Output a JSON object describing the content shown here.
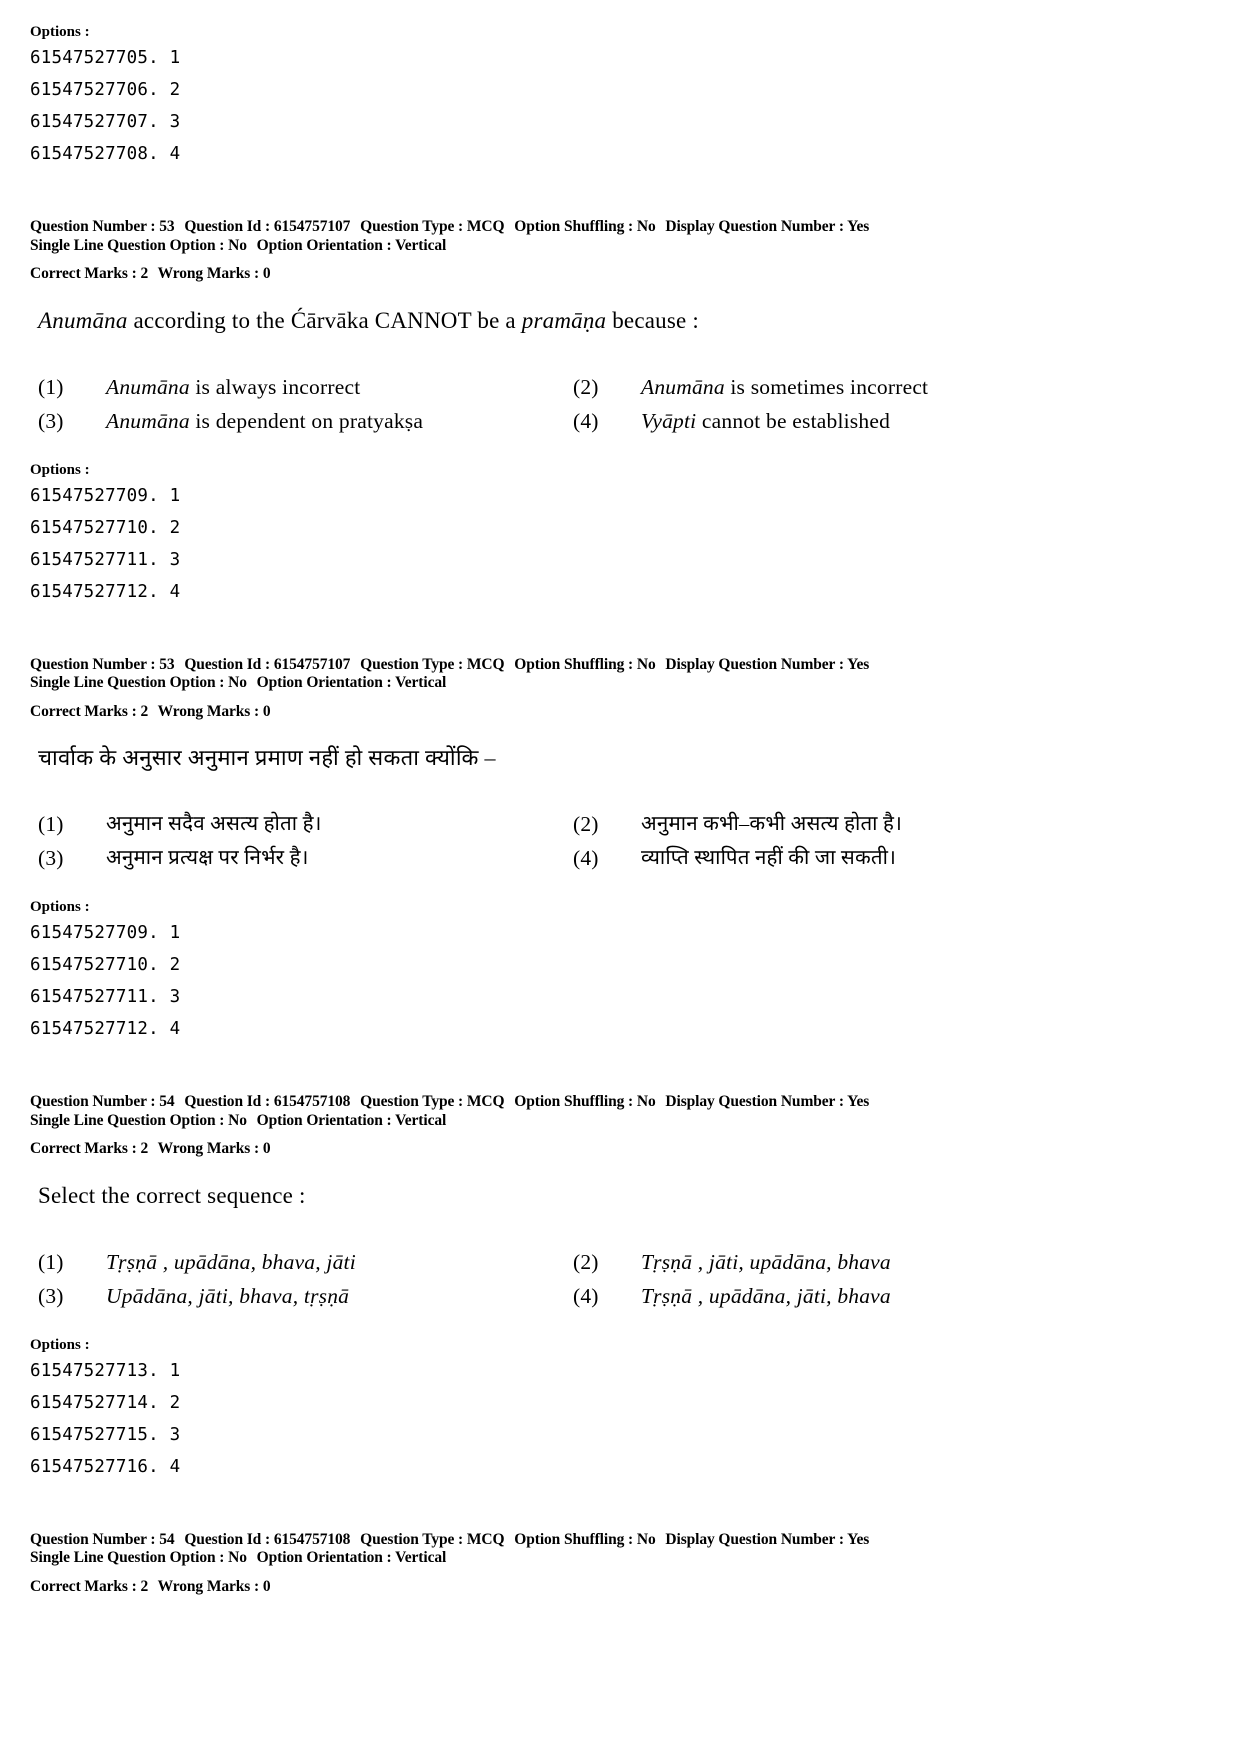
{
  "labels": {
    "options": "Options :",
    "question_number": "Question Number :",
    "question_id": "Question Id :",
    "question_type": "Question Type :",
    "option_shuffling": "Option Shuffling :",
    "display_question_number": "Display Question Number :",
    "single_line_question_option": "Single Line Question Option :",
    "option_orientation": "Option Orientation :",
    "correct_marks": "Correct Marks :",
    "wrong_marks": "Wrong Marks :"
  },
  "block_top_options": {
    "heading": "Options :",
    "ids": [
      "61547527705. 1",
      "61547527706. 2",
      "61547527707. 3",
      "61547527708. 4"
    ]
  },
  "q53_en": {
    "meta": {
      "question_number": "53",
      "question_id": "6154757107",
      "question_type": "MCQ",
      "option_shuffling": "No",
      "display_question_number": "Yes",
      "single_line_question_option": "No",
      "option_orientation": "Vertical",
      "correct_marks": "2",
      "wrong_marks": "0"
    },
    "stem_parts": {
      "p1": "Anumāna",
      "p2": " according to the Ćārvāka CANNOT be a ",
      "p3": "pramāṇa",
      "p4": "  because :"
    },
    "choices": [
      {
        "num": "(1)",
        "italic": "Anumāna",
        "rest": " is always incorrect"
      },
      {
        "num": "(2)",
        "italic": "Anumāna",
        "rest": " is sometimes incorrect"
      },
      {
        "num": "(3)",
        "italic": "Anumāna",
        "rest": " is dependent on pratyakṣa"
      },
      {
        "num": "(4)",
        "italic": "Vyāpti",
        "rest": " cannot be established"
      }
    ],
    "options": {
      "heading": "Options :",
      "ids": [
        "61547527709. 1",
        "61547527710. 2",
        "61547527711. 3",
        "61547527712. 4"
      ]
    }
  },
  "q53_hi": {
    "meta": {
      "question_number": "53",
      "question_id": "6154757107",
      "question_type": "MCQ",
      "option_shuffling": "No",
      "display_question_number": "Yes",
      "single_line_question_option": "No",
      "option_orientation": "Vertical",
      "correct_marks": "2",
      "wrong_marks": "0"
    },
    "stem": "चार्वाक के अनुसार अनुमान प्रमाण नहीं हो सकता क्योंकि –",
    "choices": [
      {
        "num": "(1)",
        "text": "अनुमान सदैव असत्य होता है।"
      },
      {
        "num": "(2)",
        "text": "अनुमान कभी–कभी असत्य होता है।"
      },
      {
        "num": "(3)",
        "text": "अनुमान प्रत्यक्ष पर निर्भर है।"
      },
      {
        "num": "(4)",
        "text": "व्याप्ति स्थापित नहीं की जा सकती।"
      }
    ],
    "options": {
      "heading": "Options :",
      "ids": [
        "61547527709. 1",
        "61547527710. 2",
        "61547527711. 3",
        "61547527712. 4"
      ]
    }
  },
  "q54_en": {
    "meta": {
      "question_number": "54",
      "question_id": "6154757108",
      "question_type": "MCQ",
      "option_shuffling": "No",
      "display_question_number": "Yes",
      "single_line_question_option": "No",
      "option_orientation": "Vertical",
      "correct_marks": "2",
      "wrong_marks": "0"
    },
    "stem": "Select the correct sequence :",
    "choices": [
      {
        "num": "(1)",
        "text": "Tṛṣṇā , upādāna, bhava, jāti"
      },
      {
        "num": "(2)",
        "text": "Tṛṣṇā , jāti, upādāna, bhava"
      },
      {
        "num": "(3)",
        "text": "Upādāna, jāti, bhava, tṛṣṇā"
      },
      {
        "num": "(4)",
        "text": "Tṛṣṇā , upādāna, jāti, bhava"
      }
    ],
    "options": {
      "heading": "Options :",
      "ids": [
        "61547527713. 1",
        "61547527714. 2",
        "61547527715. 3",
        "61547527716. 4"
      ]
    }
  },
  "q54_hi": {
    "meta": {
      "question_number": "54",
      "question_id": "6154757108",
      "question_type": "MCQ",
      "option_shuffling": "No",
      "display_question_number": "Yes",
      "single_line_question_option": "No",
      "option_orientation": "Vertical",
      "correct_marks": "2",
      "wrong_marks": "0"
    }
  }
}
